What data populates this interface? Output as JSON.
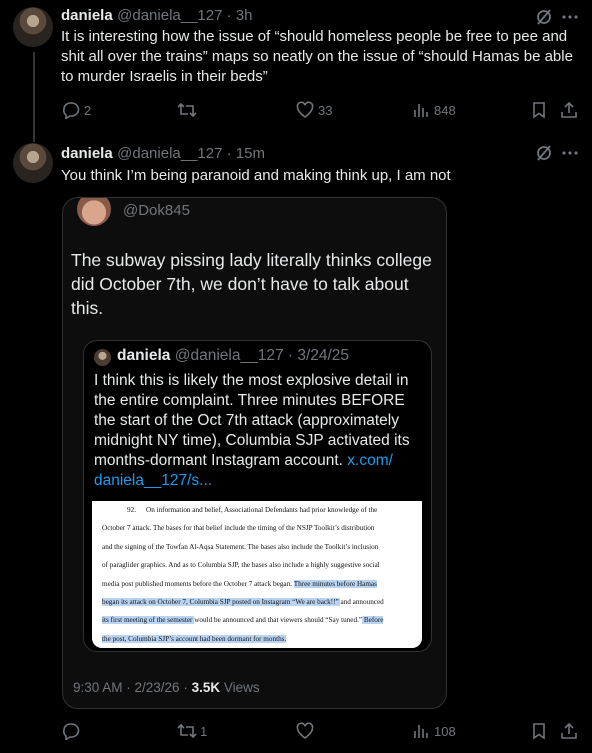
{
  "tweet1": {
    "name": "daniela",
    "handle": "@daniela__127 · 3h",
    "text": "It is interesting how the issue of “should homeless people be free to pee and shit all over the trains” maps so neatly on the issue of “should Hamas be able to murder Israelis in their beds”",
    "replies": "2",
    "likes": "33",
    "views": "848"
  },
  "tweet2": {
    "name": "daniela",
    "handle": "@daniela__127 · 15m",
    "text": "You think I’m being paranoid and making think up, I am not",
    "retweets": "1",
    "views": "108"
  },
  "quoted": {
    "handle": "@Dok845",
    "text": "The subway pissing lady literally thinks college did October 7th, we don’t have to talk about this.",
    "timestamp": "9:30 AM · 2/23/26 · ",
    "views_count": "3.5K",
    "views_label": " Views"
  },
  "inner_quote": {
    "name": "daniela",
    "handle": "@daniela__127 · 3/24/25",
    "text": "I think this is likely the most explosive detail in the entire complaint. Three minutes BEFORE the start of the Oct 7th attack (approximately midnight NY time), Columbia SJP activated its months-dormant Instagram account.",
    "link": "x.com/ daniela__127/s..."
  },
  "document": {
    "para_num": "92.",
    "line1": "On information and belief, Associational Defendants had prior knowledge of the",
    "line2": "October 7 attack. The bases for that belief include the timing of the NSJP Toolkit’s distribution",
    "line3": "and the signing of the Towfan Al-Aqsa Statement. The bases also include the Toolkit’s inclusion",
    "line4": "of paraglider graphics. And as to Columbia SJP, the bases also include a highly suggestive social",
    "line5a": "media post published moments before the October 7 attack began. ",
    "line5b": "Three minutes before Hamas",
    "line6a": "began its attack on October 7, Columbia SJP posted on Instagram “We are back!!” ",
    "line6b": "and announced",
    "line7a": "its first meeting of the semester ",
    "line7b": "would be announced and that viewers should “Say tuned.”",
    "line7c": " Before",
    "line8": "the post, Columbia SJP’s account had been dormant for months."
  }
}
